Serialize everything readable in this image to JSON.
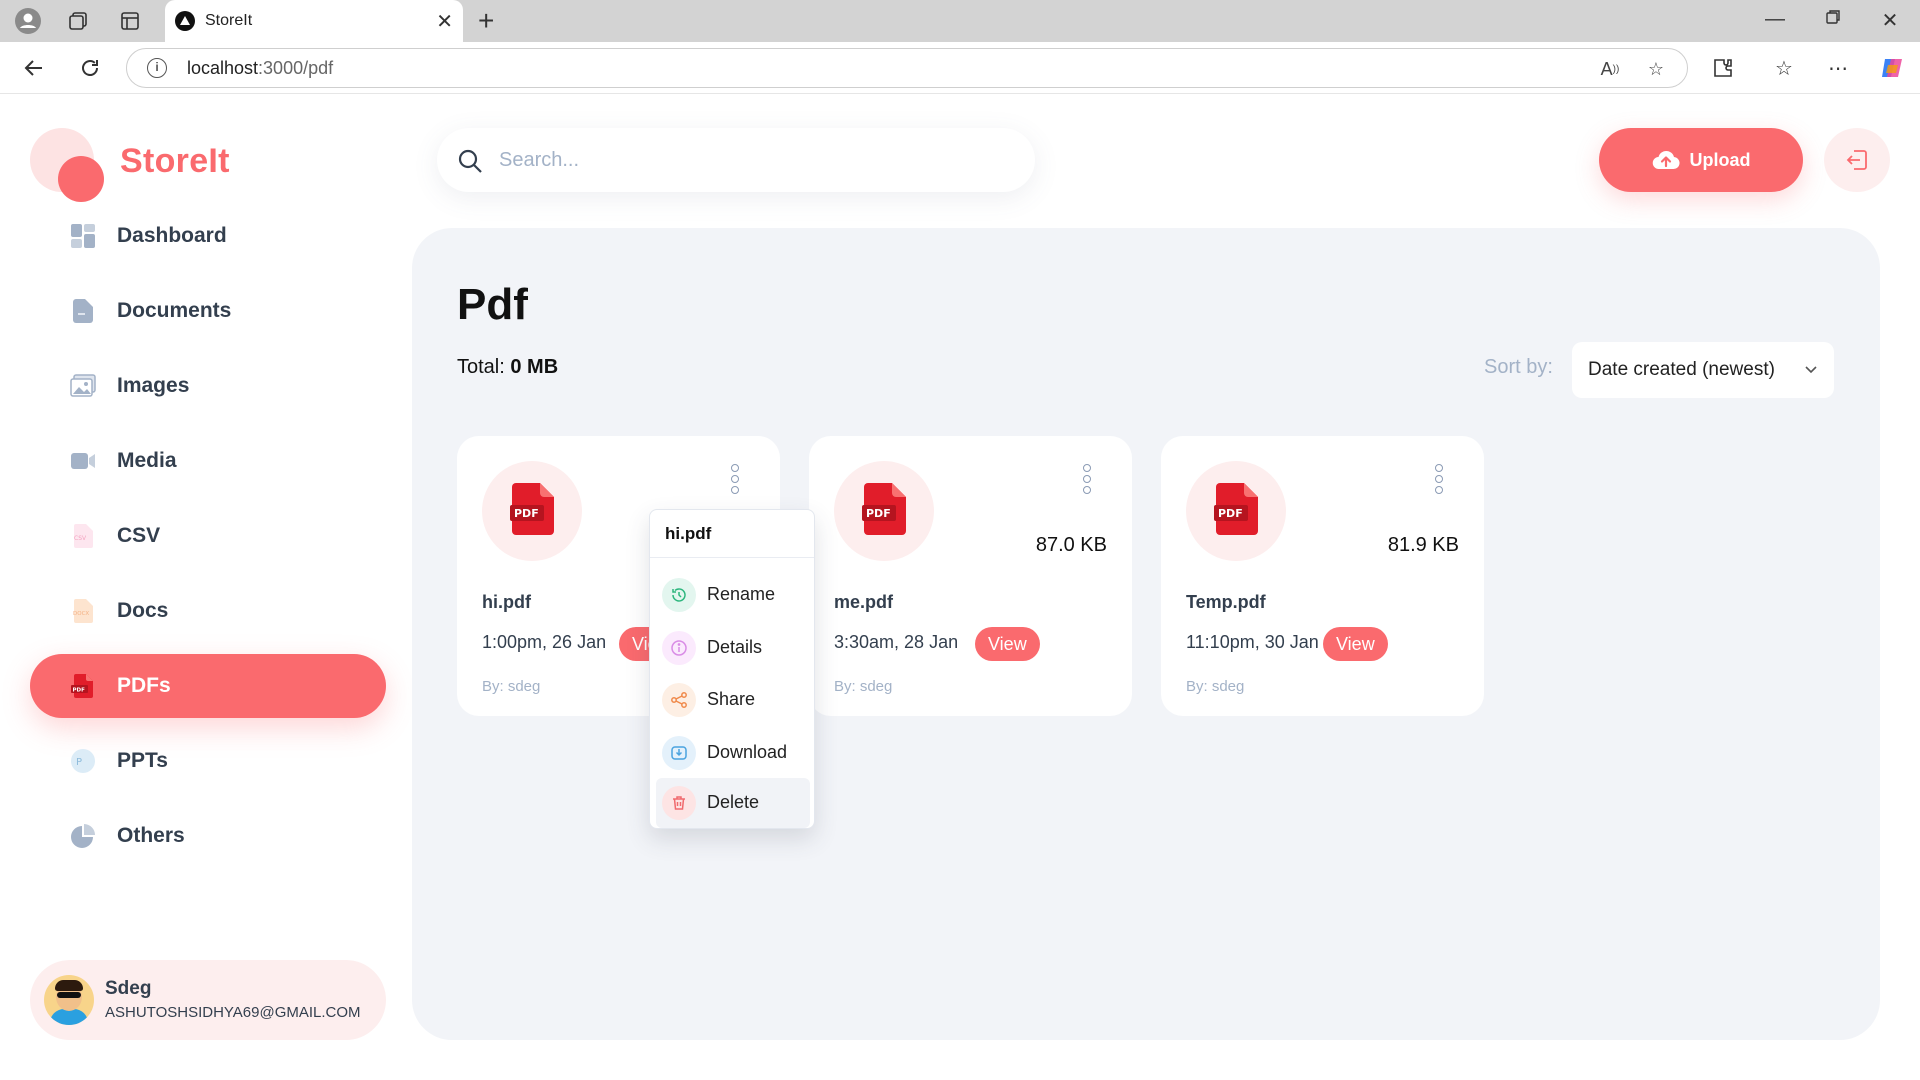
{
  "browser": {
    "tab_title": "StoreIt",
    "url_host": "localhost",
    "url_path": ":3000/pdf"
  },
  "app": {
    "logo_text": "StoreIt",
    "brand_color": "#fa6a6e"
  },
  "sidebar": {
    "items": [
      {
        "label": "Dashboard",
        "icon": "dashboard-icon"
      },
      {
        "label": "Documents",
        "icon": "documents-icon"
      },
      {
        "label": "Images",
        "icon": "images-icon"
      },
      {
        "label": "Media",
        "icon": "media-icon"
      },
      {
        "label": "CSV",
        "icon": "csv-icon"
      },
      {
        "label": "Docs",
        "icon": "docs-icon"
      },
      {
        "label": "PDFs",
        "icon": "pdf-icon",
        "active": true
      },
      {
        "label": "PPTs",
        "icon": "ppt-icon"
      },
      {
        "label": "Others",
        "icon": "pie-chart-icon"
      }
    ]
  },
  "user": {
    "name": "Sdeg",
    "email": "ASHUTOSHSIDHYA69@GMAIL.COM"
  },
  "header": {
    "search_placeholder": "Search...",
    "upload_label": "Upload"
  },
  "main": {
    "title": "Pdf",
    "total_label": "Total:",
    "total_value": "0 MB",
    "sort_label": "Sort by:",
    "sort_value": "Date created (newest)"
  },
  "files": [
    {
      "name": "hi.pdf",
      "size": "",
      "date": "1:00pm, 26 Jan",
      "view": "View",
      "by": "By: sdeg"
    },
    {
      "name": "me.pdf",
      "size": "87.0 KB",
      "date": "3:30am, 28 Jan",
      "view": "View",
      "by": "By: sdeg"
    },
    {
      "name": "Temp.pdf",
      "size": "81.9 KB",
      "date": "11:10pm, 30 Jan",
      "view": "View",
      "by": "By: sdeg"
    }
  ],
  "file_badge_text": "PDF",
  "menu": {
    "title": "hi.pdf",
    "items": [
      {
        "label": "Rename",
        "icon": "rename-icon"
      },
      {
        "label": "Details",
        "icon": "info-icon"
      },
      {
        "label": "Share",
        "icon": "share-icon"
      },
      {
        "label": "Download",
        "icon": "download-icon"
      },
      {
        "label": "Delete",
        "icon": "trash-icon"
      }
    ]
  }
}
